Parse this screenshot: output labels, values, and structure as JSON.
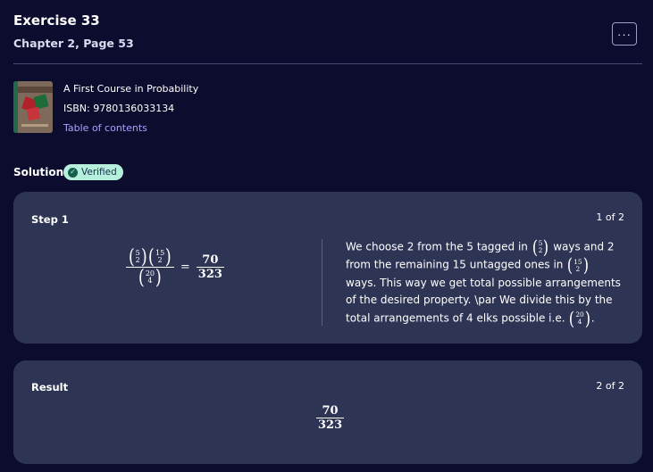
{
  "header": {
    "title": "Exercise 33",
    "subtitle": "Chapter 2, Page 53",
    "more_label": "···"
  },
  "book": {
    "title": "A First Course in Probability",
    "isbn": "ISBN: 9780136033134",
    "toc_link": "Table of contents",
    "cover_icon": "book-cover-image"
  },
  "solution": {
    "label": "Solution",
    "badge": "Verified",
    "badge_icon": "check-circle-icon",
    "badge_color": "#b6efdc"
  },
  "step": {
    "label": "Step 1",
    "count": "1 of 2",
    "equation": {
      "b1_top": "5",
      "b1_bottom": "2",
      "b2_top": "15",
      "b2_bottom": "2",
      "b3_top": "20",
      "b3_bottom": "4",
      "equals": "=",
      "num": "70",
      "den": "323"
    },
    "explanation": {
      "t1": "We choose 2 from the 5 tagged in ",
      "b1_top": "5",
      "b1_bottom": "2",
      "t2": " ways and 2 from the remaining 15 untagged ones in ",
      "b2_top": "15",
      "b2_bottom": "2",
      "t3": " ways. This way we get total possible arrangements of the desired property. \\par We divide this by the total arrangements of 4 elks possible i.e. ",
      "b3_top": "20",
      "b3_bottom": "4",
      "t4": "."
    }
  },
  "result": {
    "label": "Result",
    "count": "2 of 2",
    "num": "70",
    "den": "323"
  },
  "colors": {
    "background": "#0c0c2e",
    "card": "#2e3453",
    "link": "#a8a2ff"
  }
}
